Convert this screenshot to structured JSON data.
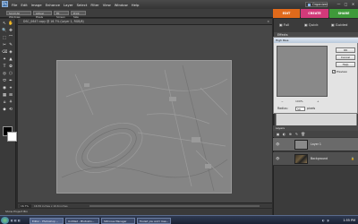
{
  "app": {
    "logo": "Ps"
  },
  "menubar": {
    "items": [
      "File",
      "Edit",
      "Image",
      "Enhance",
      "Layer",
      "Select",
      "Filter",
      "View",
      "Window",
      "Help"
    ],
    "organizer": "Organizer",
    "win_min": "—",
    "win_max": "□",
    "win_close": "✕"
  },
  "tabbar": {
    "buttons": [
      "Scroll All Windows",
      "Actual Pixels",
      "Fit Screen",
      "Print Size"
    ]
  },
  "modes": [
    {
      "label": "EDIT",
      "color": "#e06a1b"
    },
    {
      "label": "CREATE",
      "color": "#d23a7a"
    },
    {
      "label": "SHARE",
      "color": "#3f9a3a"
    }
  ],
  "right_tabs": [
    "Full",
    "Quick",
    "Guided"
  ],
  "document": {
    "title": "DSC_0647 copy @ 16.7% (Layer 1, RGB/8)",
    "zoom": "16.7%",
    "info": "16.59 inches x 10.6 inches (300 ppi)",
    "close": "×"
  },
  "effects": {
    "title": "Effects"
  },
  "high_pass": {
    "title": "High Pass",
    "ok": "OK",
    "cancel": "Cancel",
    "help": "Help",
    "preview_label": "Preview",
    "preview_checked": "✓",
    "zoom_out": "−",
    "zoom_level": "100%",
    "zoom_in": "+",
    "radius_label": "Radius:",
    "radius_value": "50",
    "radius_unit": "pixels"
  },
  "layers": {
    "title": "Layers",
    "tools": [
      "▣",
      "◐",
      "⊕",
      "✎",
      "🗑"
    ],
    "rows": [
      {
        "name": "Layer 1",
        "visible": "👁"
      },
      {
        "name": "Background",
        "visible": "👁",
        "lock": "🔒"
      }
    ]
  },
  "project_bin": {
    "label": "Show Project Bin"
  },
  "taskbar": {
    "tasks": [
      "Editor - Photoshop ...",
      "Untitled - Photosho...",
      "SDCcoes Manager",
      "Fooled you and I lose..."
    ],
    "clock": "1:55 PM"
  },
  "tools": [
    "↖",
    "✋",
    "🔍",
    "✥",
    "⬚",
    "⌒",
    "✂",
    "✎",
    "⌫",
    "◈",
    "✦",
    "▲",
    "T",
    "✿",
    "◎",
    "⬡",
    "⬭",
    "✒",
    "◉",
    "⌖",
    "▦",
    "⊞",
    "⌂",
    "⚘",
    "◆",
    "⟲"
  ]
}
